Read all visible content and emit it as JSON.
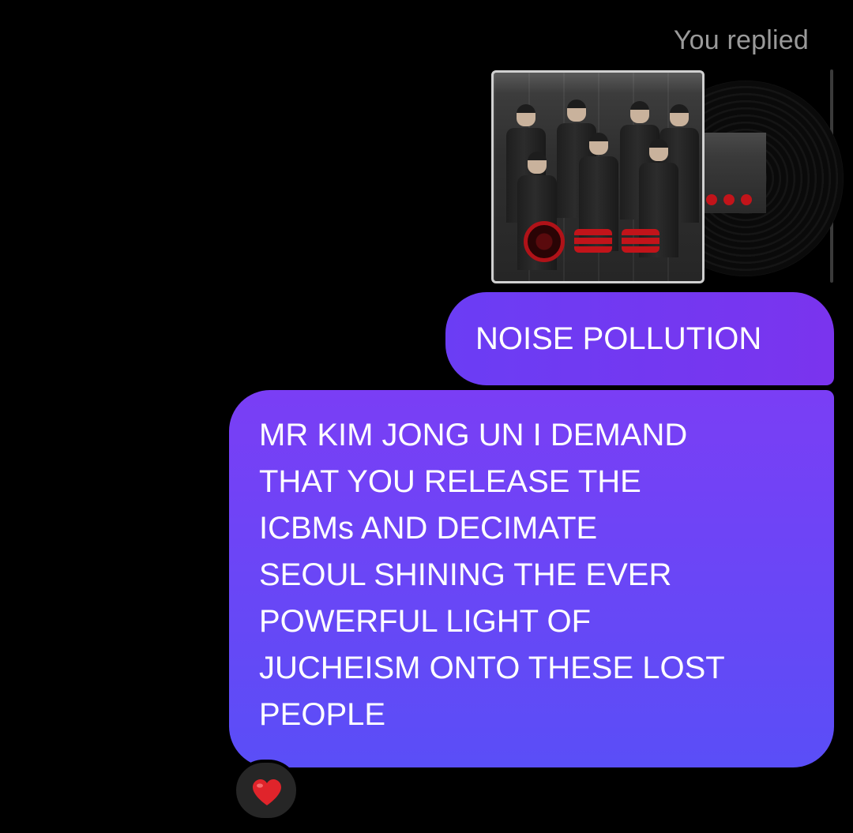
{
  "thread": {
    "reply_label": "You replied"
  },
  "shared_media": {
    "type": "album",
    "cover_icon": "album-cover-image",
    "record_icon": "vinyl-record-icon"
  },
  "messages": [
    {
      "text": "NOISE POLLUTION",
      "sender": "you"
    },
    {
      "text": "MR KIM JONG UN I DEMAND\nTHAT YOU RELEASE THE\nICBMs AND DECIMATE\nSEOUL SHINING THE EVER\nPOWERFUL LIGHT OF\nJUCHEISM ONTO THESE LOST\nPEOPLE",
      "sender": "you"
    }
  ],
  "reaction": {
    "icon": "heart-icon"
  },
  "colors": {
    "background": "#000000",
    "bubble_start": "#7a3ef5",
    "bubble_end": "#5a4ef7",
    "reply_label": "#9a9a9a",
    "heart": "#e0242b"
  }
}
